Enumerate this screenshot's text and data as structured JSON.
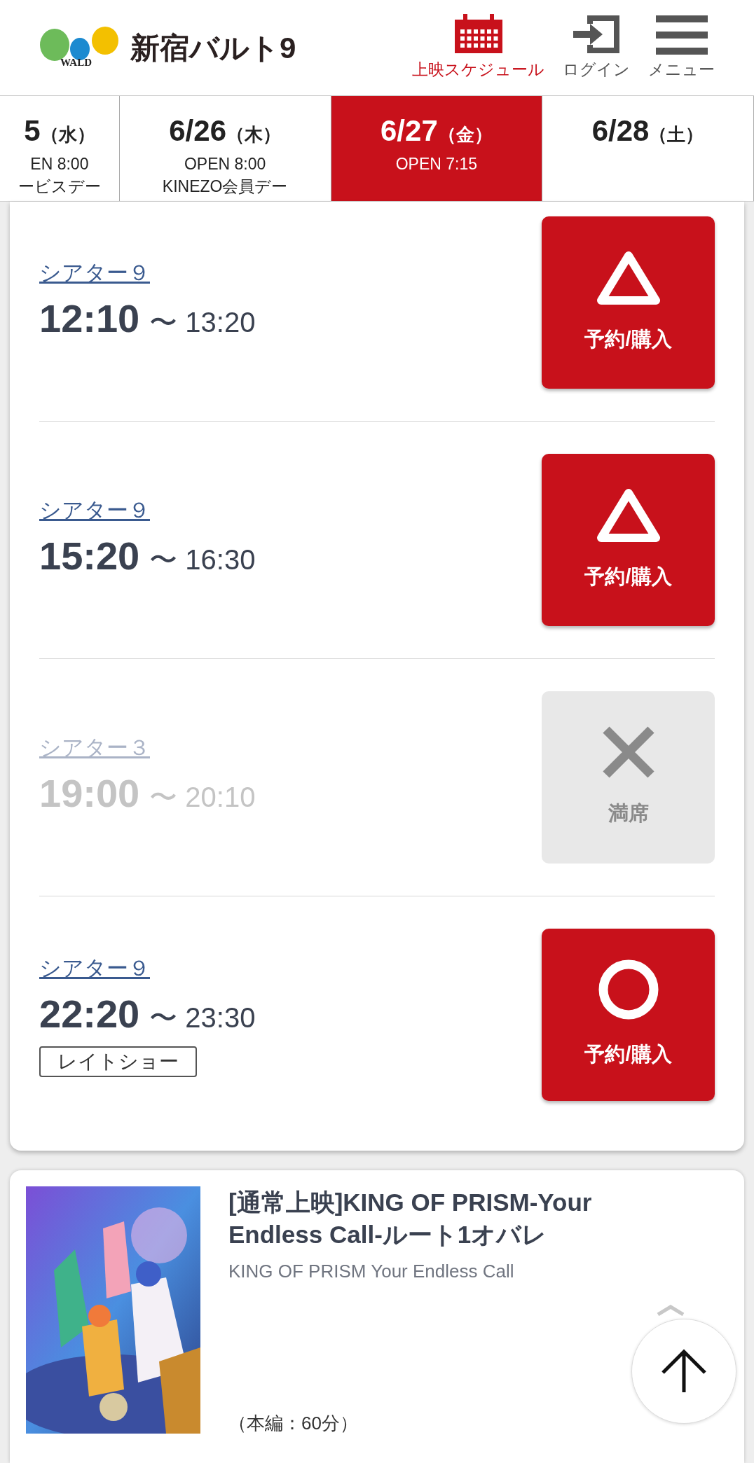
{
  "header": {
    "logo_mark": "WALD",
    "brand": "新宿バルト9",
    "nav": [
      {
        "kind": "calendar",
        "label": "上映スケジュール",
        "selected": true
      },
      {
        "kind": "login",
        "label": "ログイン",
        "selected": false
      },
      {
        "kind": "menu",
        "label": "メニュー",
        "selected": false
      }
    ]
  },
  "dates": [
    {
      "date": "5",
      "weekday": "（水）",
      "lines": [
        "EN 8:00",
        "ービスデー"
      ],
      "selected": false
    },
    {
      "date": "6/26",
      "weekday": "（木）",
      "lines": [
        "OPEN 8:00",
        "KINEZO会員デー"
      ],
      "selected": false
    },
    {
      "date": "6/27",
      "weekday": "（金）",
      "lines": [
        "OPEN 7:15"
      ],
      "selected": true
    },
    {
      "date": "6/28",
      "weekday": "（土）",
      "selected": false
    }
  ],
  "showings": [
    {
      "theater": "シアター９",
      "start": "12:10",
      "end": "〜 13:20",
      "kind": "few",
      "disabled": false,
      "button": "予約/購入"
    },
    {
      "theater": "シアター９",
      "start": "15:20",
      "end": "〜 16:30",
      "kind": "few",
      "disabled": false,
      "button": "予約/購入"
    },
    {
      "theater": "シアター３",
      "start": "19:00",
      "end": "〜 20:10",
      "kind": "full",
      "disabled": true,
      "button": "満席"
    },
    {
      "theater": "シアター９",
      "start": "22:20",
      "end": "〜 23:30",
      "kind": "available",
      "disabled": false,
      "button": "予約/購入",
      "tag": "レイトショー"
    }
  ],
  "movie": {
    "title": "[通常上映]KING OF PRISM-Your Endless Call-ルート1オバレ",
    "subtitle": "KING OF PRISM Your Endless Call",
    "runtime": "（本編：60分）"
  }
}
